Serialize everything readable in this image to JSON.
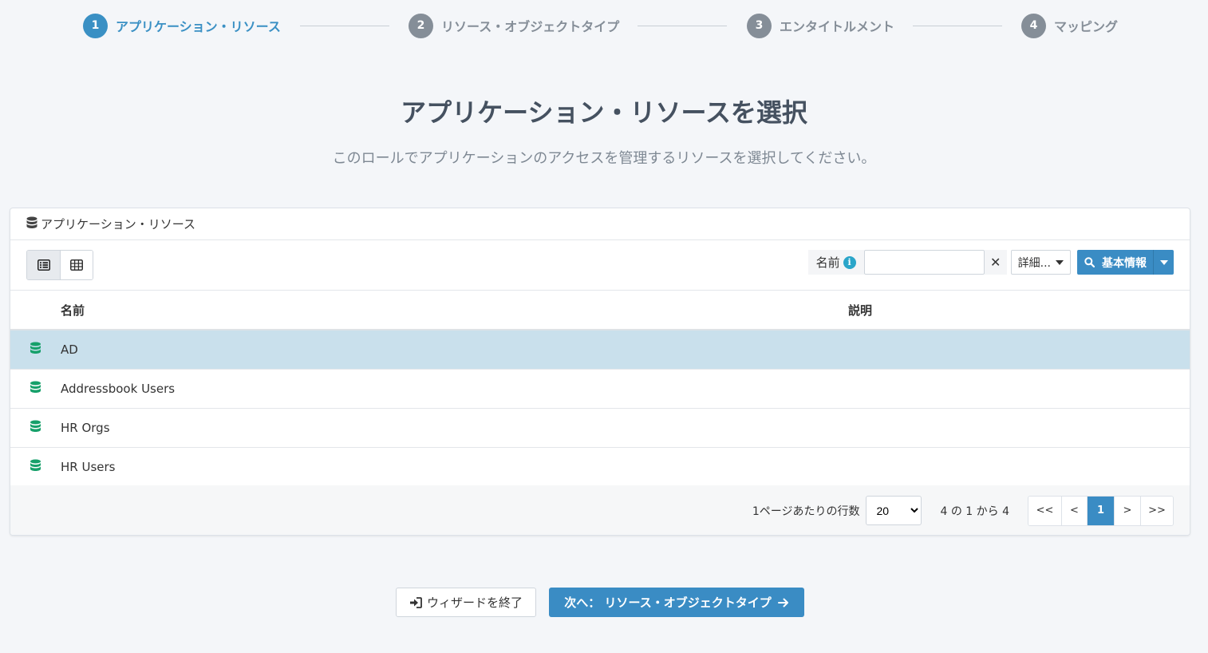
{
  "stepper": {
    "steps": [
      {
        "num": "1",
        "label": "アプリケーション・リソース",
        "active": true
      },
      {
        "num": "2",
        "label": "リソース・オブジェクトタイプ",
        "active": false
      },
      {
        "num": "3",
        "label": "エンタイトルメント",
        "active": false
      },
      {
        "num": "4",
        "label": "マッピング",
        "active": false
      }
    ]
  },
  "page": {
    "title": "アプリケーション・リソースを選択",
    "subtitle": "このロールでアプリケーションのアクセスを管理するリソースを選択してください。"
  },
  "card": {
    "header": "アプリケーション・リソース",
    "filter": {
      "label": "名前",
      "info_icon": "i",
      "value": "",
      "clear": "✕",
      "advanced": "詳細...",
      "search_label": "基本情報"
    },
    "columns": {
      "name": "名前",
      "description": "説明"
    },
    "rows": [
      {
        "name": "AD",
        "description": "",
        "selected": true
      },
      {
        "name": "Addressbook Users",
        "description": "",
        "selected": false
      },
      {
        "name": "HR Orgs",
        "description": "",
        "selected": false
      },
      {
        "name": "HR Users",
        "description": "",
        "selected": false
      }
    ],
    "pagination": {
      "rows_label": "1ページあたりの行数",
      "rows_value": "20",
      "range": "4 の 1 から 4",
      "first": "<<",
      "prev": "<",
      "current": "1",
      "next": ">",
      "last": ">>"
    }
  },
  "footer": {
    "exit_label": "ウィザードを終了",
    "next_label": "次へ： リソース・オブジェクトタイプ"
  },
  "colors": {
    "accent": "#3a8cc4",
    "db_icon": "#16a06a",
    "selected_row": "#c9e0ec"
  }
}
